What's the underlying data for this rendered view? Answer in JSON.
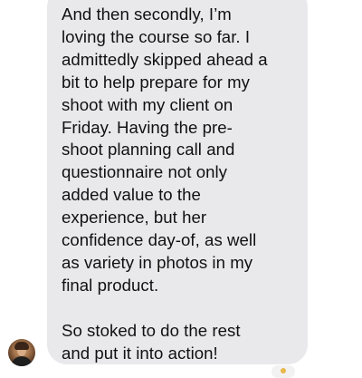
{
  "conversation": {
    "message": {
      "text": "And then secondly, I’m\nloving the course so far.  I\nadmittedly skipped ahead a\nbit to help prepare for my\nshoot with my client on\nFriday.  Having the pre-\nshoot planning call and\nquestionnaire not only\nadded value to the\nexperience, but her\nconfidence day-of, as well\nas variety in photos in my\nfinal product.\n\nSo stoked to do the rest\nand put it into action!",
      "bubble_color": "#e9e9eb",
      "text_color": "#111111"
    },
    "sender": {
      "avatar_icon": "profile-photo"
    },
    "reaction": {
      "icon": "reaction-emoji"
    }
  }
}
